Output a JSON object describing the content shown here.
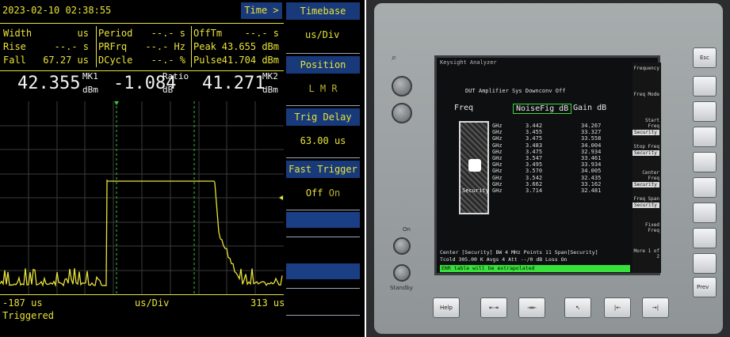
{
  "meter": {
    "datetime": "2023-02-10  02:38:55",
    "time_button": "Time >",
    "measurements": {
      "col1": [
        {
          "label": "Width",
          "value": "us"
        },
        {
          "label": "Rise",
          "value": "--.- s"
        },
        {
          "label": "Fall",
          "value": "67.27 us"
        }
      ],
      "col2": [
        {
          "label": "Period",
          "value": "--.- s"
        },
        {
          "label": "PRFrq",
          "value": "--.- Hz"
        },
        {
          "label": "DCycle",
          "value": "--.- %"
        }
      ],
      "col3": [
        {
          "label": "OffTm",
          "value": "--.- s"
        },
        {
          "label": "Peak",
          "value": "43.655 dBm"
        },
        {
          "label": "Pulse",
          "value": "41.704 dBm"
        }
      ]
    },
    "markers": {
      "mk1_value": "42.355",
      "mk1_sup": "MK1",
      "mk1_unit": "dBm",
      "ratio_value": "-1.084",
      "ratio_sup": "Ratio",
      "ratio_unit": "dB",
      "mk2_value": "41.271",
      "mk2_sup": "MK2",
      "mk2_unit": "dBm"
    },
    "axis": {
      "left": "-187 us",
      "center": "us/Div",
      "right": "313 us"
    },
    "status": "Triggered",
    "trace_color": "#e8e23a",
    "panel": {
      "timebase_title": "Timebase",
      "timebase_value": "us/Div",
      "position_title": "Position",
      "position_options": "L  M  R",
      "trig_delay_title": "Trig Delay",
      "trig_delay_value": "63.00 us",
      "fast_trigger_title": "Fast Trigger",
      "fast_trigger_off": "Off",
      "fast_trigger_on": "On"
    }
  },
  "analyzer": {
    "top_text": "Keysight  Analyzer",
    "subtitle": "DUT Amplifier    Sys Downconv Off",
    "headers": {
      "freq": "Freq",
      "noisefig": "NoiseFig dB",
      "gain": "Gain dB"
    },
    "freq_units": [
      "GHz",
      "GHz",
      "GHz",
      "GHz",
      "GHz",
      "GHz",
      "GHz",
      "GHz",
      "GHz",
      "GHz",
      "GHz"
    ],
    "noisefig_values": [
      "3.442",
      "3.455",
      "3.475",
      "3.483",
      "3.475",
      "3.547",
      "3.495",
      "3.570",
      "3.542",
      "3.662",
      "3.714"
    ],
    "gain_values": [
      "34.267",
      "33.327",
      "33.558",
      "34.004",
      "32.934",
      "33.461",
      "33.934",
      "34.005",
      "32.435",
      "33.162",
      "32.481"
    ],
    "security_label": "Security",
    "softkeys": [
      {
        "label": "Frequency",
        "sub": ""
      },
      {
        "label": "Freq Mode",
        "sub": ""
      },
      {
        "label": "Start Freq",
        "sub": "Security"
      },
      {
        "label": "Stop Freq",
        "sub": "Security"
      },
      {
        "label": "Center Freq",
        "sub": "Security"
      },
      {
        "label": "Freq Span",
        "sub": "Security"
      },
      {
        "label": "Fixed Freq",
        "sub": ""
      },
      {
        "label": "More 1 of 2",
        "sub": ""
      }
    ],
    "bottom_line1": "Center [Security]   BW 4 MHz     Points 11      Span[Security]",
    "bottom_line2": "Tcold 305.00 K    Avgs 4      Att --/0 dB     Loss On",
    "message": "ENR table will be extrapolated",
    "buttons": {
      "help": "Help",
      "on": "On",
      "standby": "Standby",
      "prev": "Prev",
      "esc": "Esc"
    }
  }
}
